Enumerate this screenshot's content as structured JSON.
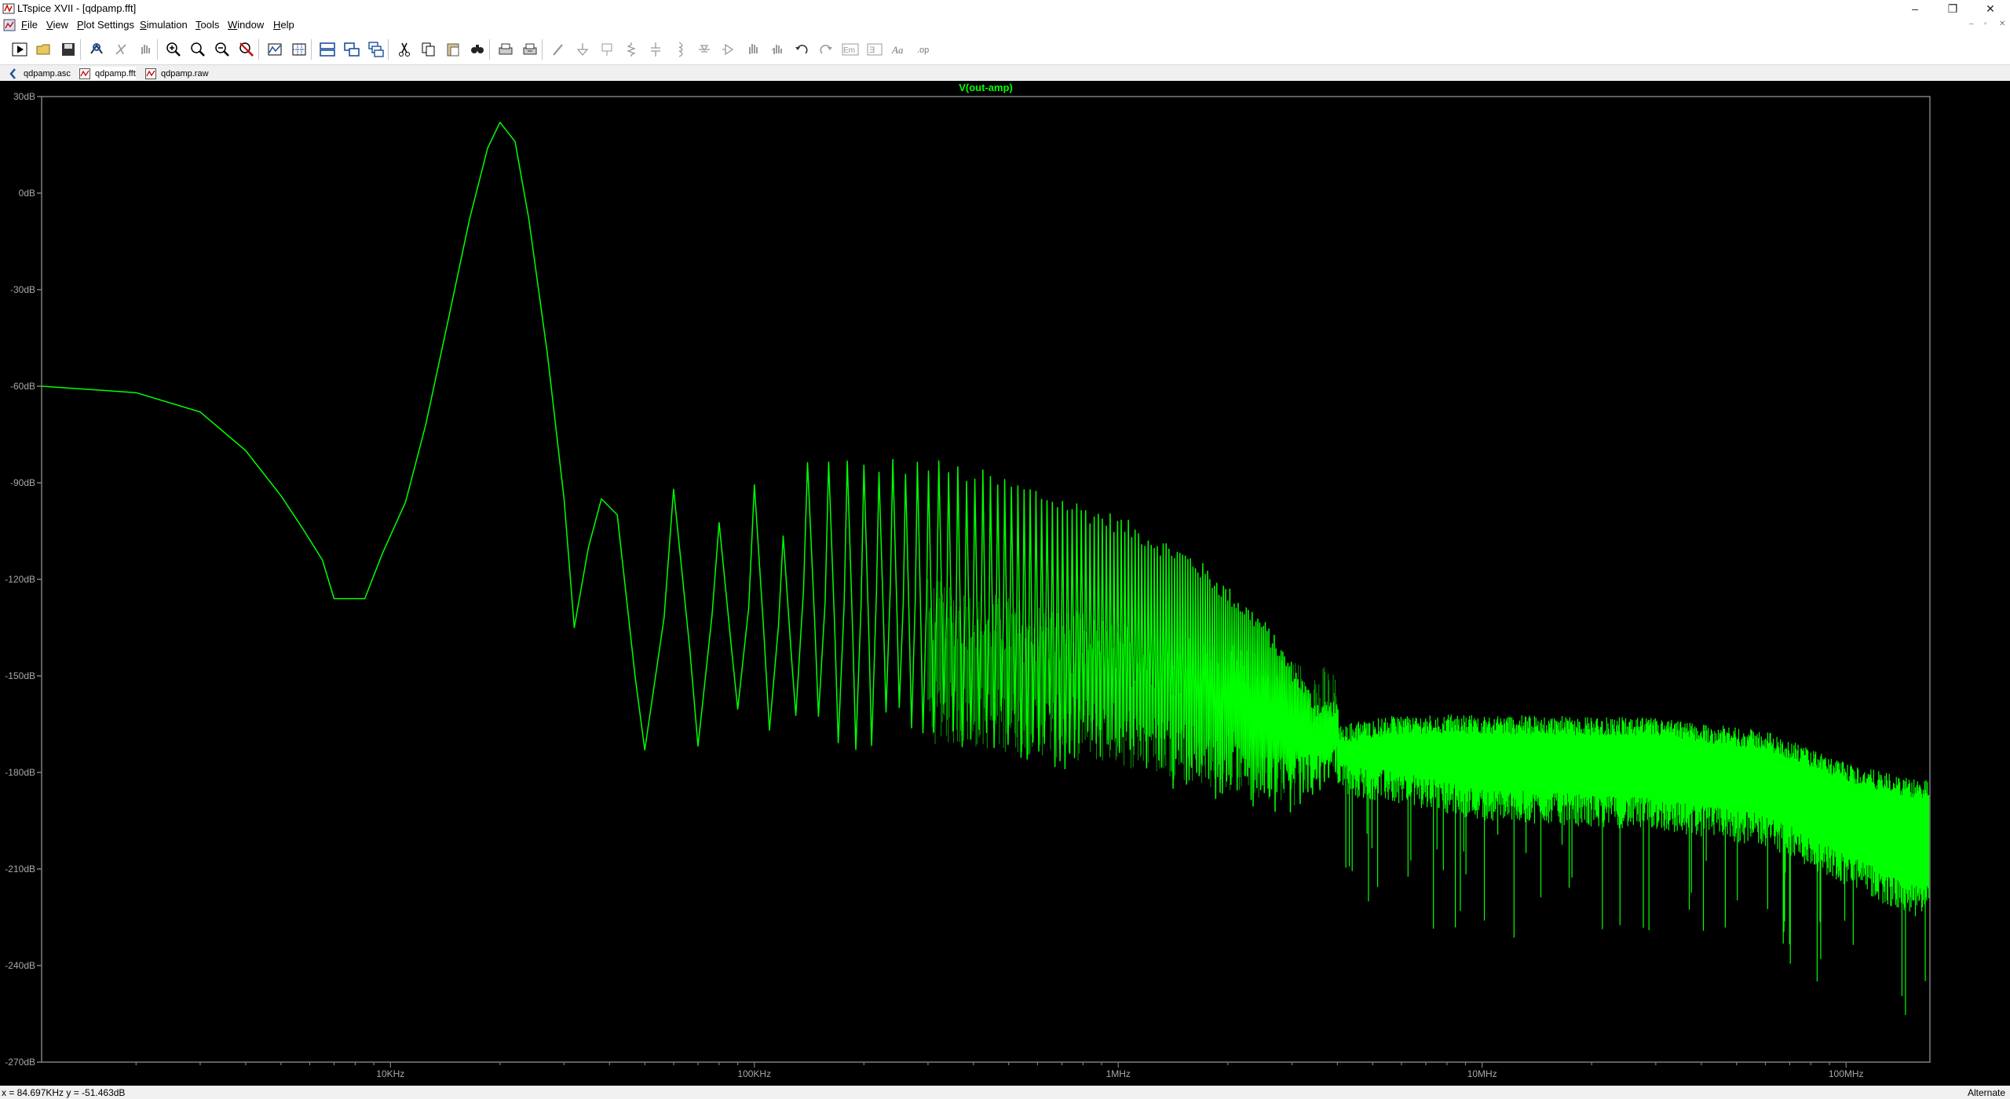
{
  "window": {
    "title": "LTspice XVII - [qdpamp.fft]",
    "controls": [
      "–",
      "❐",
      "✕"
    ],
    "mdi_controls": [
      "–",
      "▫",
      "✕"
    ]
  },
  "menu": [
    {
      "label": "File",
      "key": "F",
      "rest": "ile"
    },
    {
      "label": "View",
      "key": "V",
      "rest": "iew"
    },
    {
      "label": "Plot Settings",
      "key": "P",
      "rest": "lot Settings"
    },
    {
      "label": "Simulation",
      "key": "S",
      "rest": "imulation"
    },
    {
      "label": "Tools",
      "key": "T",
      "rest": "ools"
    },
    {
      "label": "Window",
      "key": "W",
      "rest": "indow"
    },
    {
      "label": "Help",
      "key": "H",
      "rest": "elp"
    }
  ],
  "toolbar": {
    "buttons": [
      "run-icon",
      "open-icon",
      "save-icon",
      "control-panel-icon",
      "halt-icon",
      "pan-hand-icon",
      "zoom-in-icon",
      "zoom-area-icon",
      "zoom-out-icon",
      "zoom-cancel-icon",
      "autorange-icon",
      "grid-icon",
      "tile-horizontal-icon",
      "tile-vertical-icon",
      "cascade-icon",
      "cut-icon",
      "copy-icon",
      "paste-icon",
      "find-icon",
      "print-icon",
      "print-setup-icon",
      "wire-icon",
      "ground-icon",
      "label-net-icon",
      "resistor-icon",
      "capacitor-icon",
      "inductor-icon",
      "diode-icon",
      "component-icon",
      "move-icon",
      "drag-icon",
      "undo-icon",
      "redo-icon",
      "rotate-icon",
      "mirror-icon",
      "text-icon",
      "spice-directive-icon"
    ]
  },
  "tabs": [
    {
      "label": "qdpamp.asc",
      "icon": "schematic-icon",
      "active": false
    },
    {
      "label": "qdpamp.fft",
      "icon": "waveform-icon",
      "active": true
    },
    {
      "label": "qdpamp.raw",
      "icon": "waveform-icon",
      "active": false
    }
  ],
  "status": {
    "left": "x = 84.697KHz   y = -51.463dB",
    "right": "Alternate"
  },
  "colors": {
    "trace": "#00ff00",
    "background": "#000000",
    "axis": "#7f7f7f",
    "label": "#a8a8a8"
  },
  "chart_data": {
    "type": "line",
    "title": "V(out-amp)",
    "xlabel": "",
    "ylabel": "",
    "x_scale": "log",
    "xlim": [
      1100,
      170000000
    ],
    "ylim": [
      -270,
      30
    ],
    "x_ticks": [
      {
        "value": 10000,
        "label": "10KHz"
      },
      {
        "value": 100000,
        "label": "100KHz"
      },
      {
        "value": 1000000,
        "label": "1MHz"
      },
      {
        "value": 10000000,
        "label": "10MHz"
      },
      {
        "value": 100000000,
        "label": "100MHz"
      }
    ],
    "y_ticks": [
      {
        "value": 30,
        "label": "30dB"
      },
      {
        "value": 0,
        "label": "0dB"
      },
      {
        "value": -30,
        "label": "-30dB"
      },
      {
        "value": -60,
        "label": "-60dB"
      },
      {
        "value": -90,
        "label": "-90dB"
      },
      {
        "value": -120,
        "label": "-120dB"
      },
      {
        "value": -150,
        "label": "-150dB"
      },
      {
        "value": -180,
        "label": "-180dB"
      },
      {
        "value": -210,
        "label": "-210dB"
      },
      {
        "value": -240,
        "label": "-240dB"
      },
      {
        "value": -270,
        "label": "-270dB"
      }
    ],
    "grid": false,
    "series": [
      {
        "name": "V(out-amp)",
        "color": "#00ff00",
        "envelope": [
          [
            1100,
            -60
          ],
          [
            2000,
            -62
          ],
          [
            3000,
            -68
          ],
          [
            4000,
            -80
          ],
          [
            5000,
            -94
          ],
          [
            5800,
            -105
          ],
          [
            6500,
            -114
          ],
          [
            7000,
            -126
          ],
          [
            8500,
            -126
          ],
          [
            9500,
            -112
          ],
          [
            11000,
            -96
          ],
          [
            12500,
            -72
          ],
          [
            14500,
            -38
          ],
          [
            16500,
            -8
          ],
          [
            18500,
            14
          ],
          [
            20000,
            22
          ],
          [
            22000,
            16
          ],
          [
            24000,
            -8
          ],
          [
            27000,
            -50
          ],
          [
            30000,
            -95
          ],
          [
            32000,
            -135
          ],
          [
            35000,
            -110
          ],
          [
            38000,
            -95
          ],
          [
            42000,
            -100
          ],
          [
            47000,
            -150
          ],
          [
            50000,
            -173
          ]
        ],
        "peaks": [
          [
            40000,
            -91
          ],
          [
            61000,
            -93
          ],
          [
            75000,
            -110
          ],
          [
            95000,
            -85
          ],
          [
            115000,
            -110
          ],
          [
            140000,
            -85
          ],
          [
            180000,
            -85
          ],
          [
            230000,
            -85
          ],
          [
            300000,
            -85
          ],
          [
            400000,
            -88
          ],
          [
            600000,
            -94
          ],
          [
            1000000,
            -103
          ],
          [
            1600000,
            -115
          ],
          [
            2500000,
            -135
          ],
          [
            3500000,
            -160
          ]
        ],
        "notch_floor": [
          [
            55000,
            -168
          ],
          [
            100000,
            -170
          ],
          [
            300000,
            -165
          ],
          [
            1000000,
            -172
          ],
          [
            3000000,
            -185
          ],
          [
            4000000,
            -172
          ]
        ],
        "noise_band": [
          [
            4000000,
            -168,
            -182
          ],
          [
            6000000,
            -165,
            -185
          ],
          [
            10000000,
            -165,
            -190
          ],
          [
            30000000,
            -166,
            -193
          ],
          [
            60000000,
            -170,
            -198
          ],
          [
            100000000,
            -180,
            -210
          ],
          [
            150000000,
            -185,
            -220
          ]
        ]
      }
    ]
  }
}
